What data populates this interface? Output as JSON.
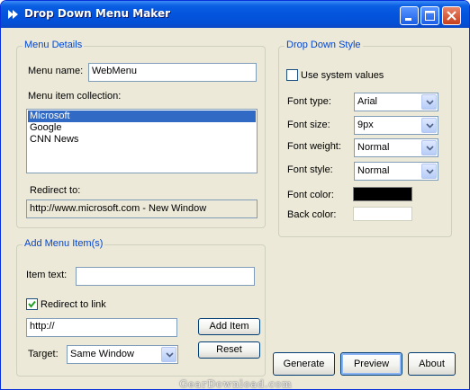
{
  "window": {
    "title": "Drop Down Menu Maker"
  },
  "menu_details": {
    "group_title": "Menu Details",
    "menu_name_label": "Menu name:",
    "menu_name_value": "WebMenu",
    "collection_label": "Menu item collection:",
    "items": [
      {
        "label": "Microsoft",
        "selected": true
      },
      {
        "label": "Google",
        "selected": false
      },
      {
        "label": "CNN News",
        "selected": false
      }
    ],
    "redirect_label": "Redirect to:",
    "redirect_value": "http://www.microsoft.com - New Window"
  },
  "add_item": {
    "group_title": "Add Menu Item(s)",
    "item_text_label": "Item text:",
    "item_text_value": "",
    "redirect_checkbox_label": "Redirect to link",
    "redirect_checked": true,
    "url_value": "http://",
    "add_button": "Add Item",
    "reset_button": "Reset",
    "target_label": "Target:",
    "target_value": "Same Window"
  },
  "style": {
    "group_title": "Drop Down Style",
    "use_system_label": "Use system values",
    "use_system_checked": false,
    "font_type_label": "Font type:",
    "font_type_value": "Arial",
    "font_size_label": "Font size:",
    "font_size_value": "9px",
    "font_weight_label": "Font weight:",
    "font_weight_value": "Normal",
    "font_style_label": "Font style:",
    "font_style_value": "Normal",
    "font_color_label": "Font color:",
    "font_color": "#000000",
    "back_color_label": "Back color:",
    "back_color": "#ffffff"
  },
  "buttons": {
    "generate": "Generate",
    "preview": "Preview",
    "about": "About"
  },
  "watermark": "GearDownload.com",
  "colors": {
    "titlebar": "#0454dd",
    "group_title": "#0046d5",
    "selection": "#316ac5"
  }
}
